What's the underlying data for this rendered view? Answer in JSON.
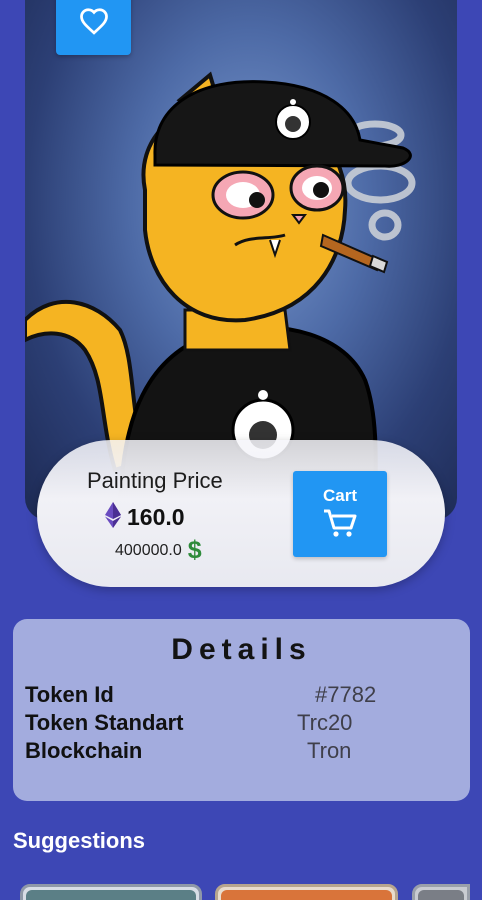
{
  "artwork": {
    "badge_icon": "cat-astronaut-icon",
    "favorite_icon": "heart-outline-icon"
  },
  "price": {
    "title": "Painting Price",
    "eth_icon": "ethereum-icon",
    "eth_value": "160.0",
    "usd_value": "400000.0",
    "usd_sign": "$",
    "cart_label": "Cart",
    "cart_icon": "cart-plus-icon"
  },
  "details": {
    "title": "Details",
    "rows": [
      {
        "label": "Token Id",
        "value": "#7782"
      },
      {
        "label": "Token Standart",
        "value": "Trc20"
      },
      {
        "label": "Blockchain",
        "value": "Tron"
      }
    ]
  },
  "suggestions": {
    "title": "Suggestions"
  },
  "colors": {
    "background": "#3d47b5",
    "accent": "#2196f3",
    "card": "#a3acde",
    "dollar": "#2e8b3a",
    "eth": "#5b3fa6"
  }
}
